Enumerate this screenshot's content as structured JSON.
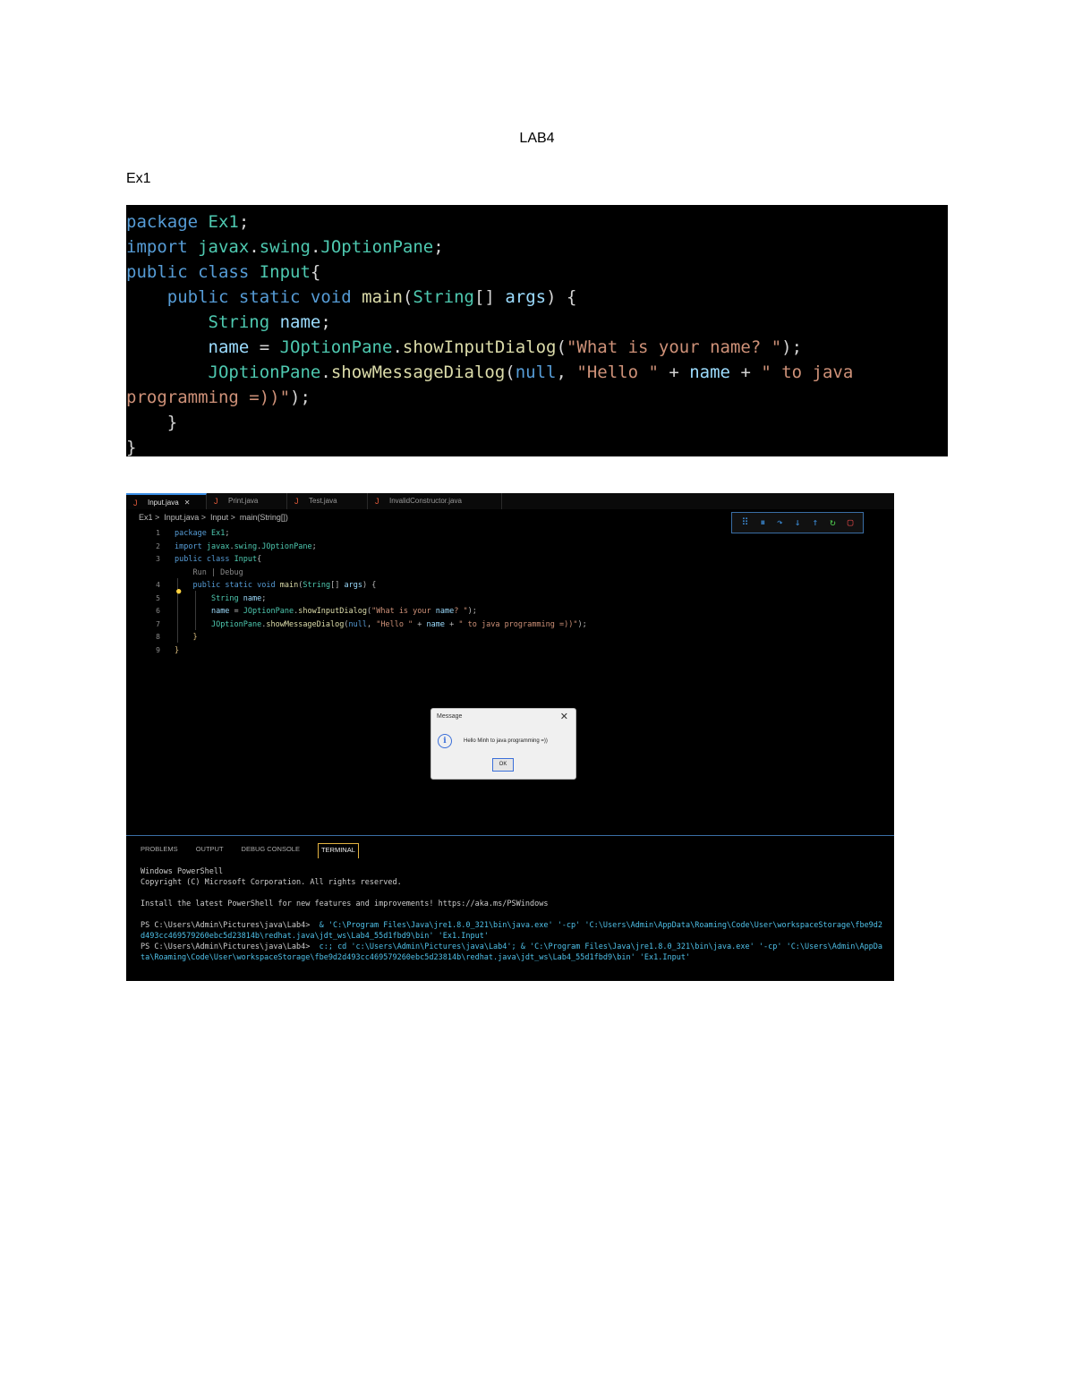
{
  "document": {
    "title": "LAB4",
    "section": "Ex1"
  },
  "code_block": {
    "lines": [
      [
        {
          "t": "package ",
          "c": "kw"
        },
        {
          "t": "Ex1",
          "c": "ty"
        },
        {
          "t": ";",
          "c": "pu"
        }
      ],
      [
        {
          "t": "import ",
          "c": "kw"
        },
        {
          "t": "javax",
          "c": "ty"
        },
        {
          "t": ".",
          "c": "pu"
        },
        {
          "t": "swing",
          "c": "ty"
        },
        {
          "t": ".",
          "c": "pu"
        },
        {
          "t": "JOptionPane",
          "c": "ty"
        },
        {
          "t": ";",
          "c": "pu"
        }
      ],
      [
        {
          "t": "public ",
          "c": "kw"
        },
        {
          "t": "class ",
          "c": "kw"
        },
        {
          "t": "Input",
          "c": "ty"
        },
        {
          "t": "{",
          "c": "pu"
        }
      ],
      [
        {
          "t": "    ",
          "c": "pu"
        },
        {
          "t": "public ",
          "c": "kw"
        },
        {
          "t": "static ",
          "c": "kw"
        },
        {
          "t": "void ",
          "c": "kw"
        },
        {
          "t": "main",
          "c": "fn"
        },
        {
          "t": "(",
          "c": "pu"
        },
        {
          "t": "String",
          "c": "ty"
        },
        {
          "t": "[] ",
          "c": "pu"
        },
        {
          "t": "args",
          "c": "va"
        },
        {
          "t": ") {",
          "c": "pu"
        }
      ],
      [
        {
          "t": "        ",
          "c": "pu"
        },
        {
          "t": "String ",
          "c": "ty"
        },
        {
          "t": "name",
          "c": "va"
        },
        {
          "t": ";",
          "c": "pu"
        }
      ],
      [
        {
          "t": "        ",
          "c": "pu"
        },
        {
          "t": "name",
          "c": "va"
        },
        {
          "t": " = ",
          "c": "pu"
        },
        {
          "t": "JOptionPane",
          "c": "ty"
        },
        {
          "t": ".",
          "c": "pu"
        },
        {
          "t": "showInputDialog",
          "c": "fn"
        },
        {
          "t": "(",
          "c": "pu"
        },
        {
          "t": "\"What is your name? \"",
          "c": "st"
        },
        {
          "t": ");",
          "c": "pu"
        }
      ],
      [
        {
          "t": "        ",
          "c": "pu"
        },
        {
          "t": "JOptionPane",
          "c": "ty"
        },
        {
          "t": ".",
          "c": "pu"
        },
        {
          "t": "showMessageDialog",
          "c": "fn"
        },
        {
          "t": "(",
          "c": "pu"
        },
        {
          "t": "null",
          "c": "kw"
        },
        {
          "t": ", ",
          "c": "pu"
        },
        {
          "t": "\"Hello \"",
          "c": "st"
        },
        {
          "t": " + ",
          "c": "pu"
        },
        {
          "t": "name",
          "c": "va"
        },
        {
          "t": " + ",
          "c": "pu"
        },
        {
          "t": "\" to java",
          "c": "st"
        }
      ],
      [
        {
          "t": "programming =))\"",
          "c": "st"
        },
        {
          "t": ");",
          "c": "pu"
        }
      ],
      [
        {
          "t": "    }",
          "c": "pu"
        }
      ],
      [
        {
          "t": "}",
          "c": "pu"
        }
      ]
    ]
  },
  "ide": {
    "tabs": [
      {
        "label": "Input.java",
        "active": true
      },
      {
        "label": "Print.java",
        "active": false
      },
      {
        "label": "Test.java",
        "active": false
      },
      {
        "label": "InvalidConstructor.java",
        "active": false
      }
    ],
    "close_glyph": "✕",
    "tab_icon": "J",
    "breadcrumb": "Ex1 >  Input.java >  Input >  main(String[])",
    "toolbar_icons": [
      "⠿",
      "⏸",
      "↷",
      "↓",
      "↑",
      "↻",
      "▢"
    ],
    "line_numbers": [
      "1",
      "2",
      "3",
      "",
      "4",
      "5",
      "6",
      "7",
      "8",
      "9"
    ],
    "code_lines": [
      "package Ex1;",
      "import javax.swing.JOptionPane;",
      "public class Input{",
      "    Run | Debug",
      "    public static void main(String[] args) {",
      "        String name;",
      "        name = JOptionPane.showInputDialog(\"What is your name? \");",
      "        JOptionPane.showMessageDialog(null, \"Hello \" + name + \" to java programming =))\");",
      "    }",
      "}"
    ],
    "dialog": {
      "title": "Message",
      "message": "Hello Minh to java programming =))",
      "ok": "OK",
      "info_glyph": "i",
      "close_glyph": "✕"
    },
    "panel": {
      "tabs": [
        "PROBLEMS",
        "OUTPUT",
        "DEBUG CONSOLE",
        "TERMINAL"
      ],
      "active_tab": "TERMINAL",
      "terminal_lines": [
        {
          "text": "Windows PowerShell",
          "cmd": false
        },
        {
          "text": "Copyright (C) Microsoft Corporation. All rights reserved.",
          "cmd": false
        },
        {
          "text": "",
          "cmd": false
        },
        {
          "text": "Install the latest PowerShell for new features and improvements! https://aka.ms/PSWindows",
          "cmd": false
        },
        {
          "text": "",
          "cmd": false
        },
        {
          "text": "PS C:\\Users\\Admin\\Pictures\\java\\Lab4>  & 'C:\\Program Files\\Java\\jre1.8.0_321\\bin\\java.exe' '-cp' 'C:\\Users\\Admin\\AppData\\Roaming\\Code\\User\\workspaceStorage\\fbe9d2d493cc469579260ebc5d23814b\\redhat.java\\jdt_ws\\Lab4_55d1fbd9\\bin' 'Ex1.Input'",
          "cmd": true
        },
        {
          "text": "PS C:\\Users\\Admin\\Pictures\\java\\Lab4>  c:; cd 'c:\\Users\\Admin\\Pictures\\java\\Lab4'; & 'C:\\Program Files\\Java\\jre1.8.0_321\\bin\\java.exe' '-cp' 'C:\\Users\\Admin\\AppData\\Roaming\\Code\\User\\workspaceStorage\\fbe9d2d493cc469579260ebc5d23814b\\redhat.java\\jdt_ws\\Lab4_55d1fbd9\\bin' 'Ex1.Input'",
          "cmd": true
        }
      ]
    }
  }
}
